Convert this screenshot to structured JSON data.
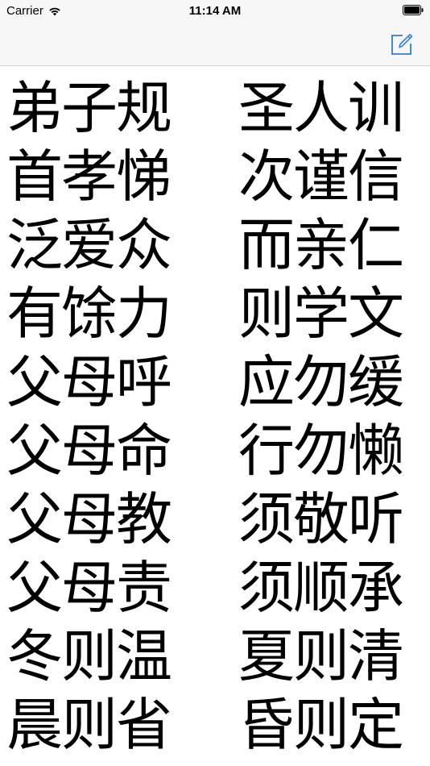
{
  "status_bar": {
    "carrier": "Carrier",
    "time": "11:14 AM",
    "wifi_icon": "wifi-icon",
    "battery_icon": "battery-icon"
  },
  "nav_bar": {
    "compose_icon": "compose-icon",
    "tint_color": "#2f7ed8"
  },
  "verses": [
    {
      "left": "弟子规",
      "right": "圣人训"
    },
    {
      "left": "首孝悌",
      "right": "次谨信"
    },
    {
      "left": "泛爱众",
      "right": "而亲仁"
    },
    {
      "left": "有馀力",
      "right": "则学文"
    },
    {
      "left": "父母呼",
      "right": "应勿缓"
    },
    {
      "left": "父母命",
      "right": "行勿懒"
    },
    {
      "left": "父母教",
      "right": "须敬听"
    },
    {
      "left": "父母责",
      "right": "须顺承"
    },
    {
      "left": "冬则温",
      "right": "夏则清"
    },
    {
      "left": "晨则省",
      "right": "昏则定"
    }
  ]
}
